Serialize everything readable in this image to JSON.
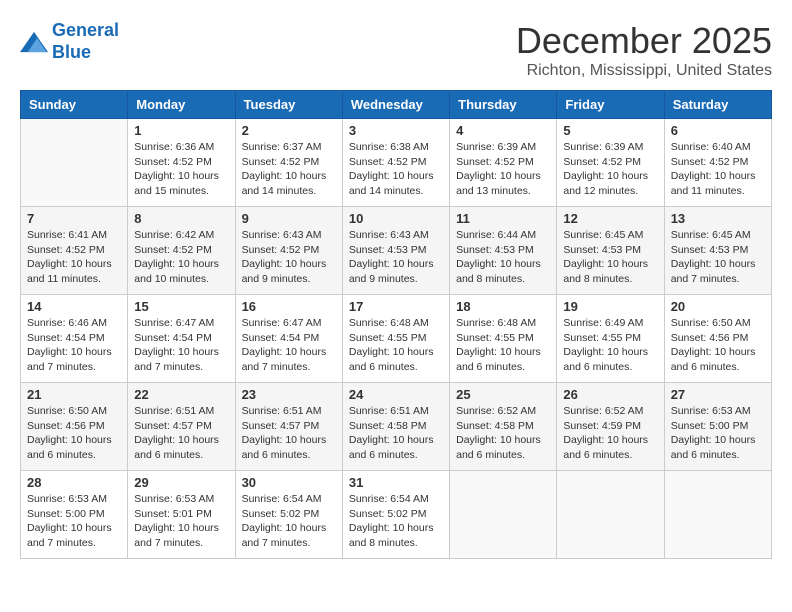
{
  "header": {
    "logo": {
      "line1": "General",
      "line2": "Blue"
    },
    "title": "December 2025",
    "location": "Richton, Mississippi, United States"
  },
  "days_of_week": [
    "Sunday",
    "Monday",
    "Tuesday",
    "Wednesday",
    "Thursday",
    "Friday",
    "Saturday"
  ],
  "weeks": [
    [
      {
        "day": "",
        "info": ""
      },
      {
        "day": "1",
        "info": "Sunrise: 6:36 AM\nSunset: 4:52 PM\nDaylight: 10 hours\nand 15 minutes."
      },
      {
        "day": "2",
        "info": "Sunrise: 6:37 AM\nSunset: 4:52 PM\nDaylight: 10 hours\nand 14 minutes."
      },
      {
        "day": "3",
        "info": "Sunrise: 6:38 AM\nSunset: 4:52 PM\nDaylight: 10 hours\nand 14 minutes."
      },
      {
        "day": "4",
        "info": "Sunrise: 6:39 AM\nSunset: 4:52 PM\nDaylight: 10 hours\nand 13 minutes."
      },
      {
        "day": "5",
        "info": "Sunrise: 6:39 AM\nSunset: 4:52 PM\nDaylight: 10 hours\nand 12 minutes."
      },
      {
        "day": "6",
        "info": "Sunrise: 6:40 AM\nSunset: 4:52 PM\nDaylight: 10 hours\nand 11 minutes."
      }
    ],
    [
      {
        "day": "7",
        "info": "Sunrise: 6:41 AM\nSunset: 4:52 PM\nDaylight: 10 hours\nand 11 minutes."
      },
      {
        "day": "8",
        "info": "Sunrise: 6:42 AM\nSunset: 4:52 PM\nDaylight: 10 hours\nand 10 minutes."
      },
      {
        "day": "9",
        "info": "Sunrise: 6:43 AM\nSunset: 4:52 PM\nDaylight: 10 hours\nand 9 minutes."
      },
      {
        "day": "10",
        "info": "Sunrise: 6:43 AM\nSunset: 4:53 PM\nDaylight: 10 hours\nand 9 minutes."
      },
      {
        "day": "11",
        "info": "Sunrise: 6:44 AM\nSunset: 4:53 PM\nDaylight: 10 hours\nand 8 minutes."
      },
      {
        "day": "12",
        "info": "Sunrise: 6:45 AM\nSunset: 4:53 PM\nDaylight: 10 hours\nand 8 minutes."
      },
      {
        "day": "13",
        "info": "Sunrise: 6:45 AM\nSunset: 4:53 PM\nDaylight: 10 hours\nand 7 minutes."
      }
    ],
    [
      {
        "day": "14",
        "info": "Sunrise: 6:46 AM\nSunset: 4:54 PM\nDaylight: 10 hours\nand 7 minutes."
      },
      {
        "day": "15",
        "info": "Sunrise: 6:47 AM\nSunset: 4:54 PM\nDaylight: 10 hours\nand 7 minutes."
      },
      {
        "day": "16",
        "info": "Sunrise: 6:47 AM\nSunset: 4:54 PM\nDaylight: 10 hours\nand 7 minutes."
      },
      {
        "day": "17",
        "info": "Sunrise: 6:48 AM\nSunset: 4:55 PM\nDaylight: 10 hours\nand 6 minutes."
      },
      {
        "day": "18",
        "info": "Sunrise: 6:48 AM\nSunset: 4:55 PM\nDaylight: 10 hours\nand 6 minutes."
      },
      {
        "day": "19",
        "info": "Sunrise: 6:49 AM\nSunset: 4:55 PM\nDaylight: 10 hours\nand 6 minutes."
      },
      {
        "day": "20",
        "info": "Sunrise: 6:50 AM\nSunset: 4:56 PM\nDaylight: 10 hours\nand 6 minutes."
      }
    ],
    [
      {
        "day": "21",
        "info": "Sunrise: 6:50 AM\nSunset: 4:56 PM\nDaylight: 10 hours\nand 6 minutes."
      },
      {
        "day": "22",
        "info": "Sunrise: 6:51 AM\nSunset: 4:57 PM\nDaylight: 10 hours\nand 6 minutes."
      },
      {
        "day": "23",
        "info": "Sunrise: 6:51 AM\nSunset: 4:57 PM\nDaylight: 10 hours\nand 6 minutes."
      },
      {
        "day": "24",
        "info": "Sunrise: 6:51 AM\nSunset: 4:58 PM\nDaylight: 10 hours\nand 6 minutes."
      },
      {
        "day": "25",
        "info": "Sunrise: 6:52 AM\nSunset: 4:58 PM\nDaylight: 10 hours\nand 6 minutes."
      },
      {
        "day": "26",
        "info": "Sunrise: 6:52 AM\nSunset: 4:59 PM\nDaylight: 10 hours\nand 6 minutes."
      },
      {
        "day": "27",
        "info": "Sunrise: 6:53 AM\nSunset: 5:00 PM\nDaylight: 10 hours\nand 6 minutes."
      }
    ],
    [
      {
        "day": "28",
        "info": "Sunrise: 6:53 AM\nSunset: 5:00 PM\nDaylight: 10 hours\nand 7 minutes."
      },
      {
        "day": "29",
        "info": "Sunrise: 6:53 AM\nSunset: 5:01 PM\nDaylight: 10 hours\nand 7 minutes."
      },
      {
        "day": "30",
        "info": "Sunrise: 6:54 AM\nSunset: 5:02 PM\nDaylight: 10 hours\nand 7 minutes."
      },
      {
        "day": "31",
        "info": "Sunrise: 6:54 AM\nSunset: 5:02 PM\nDaylight: 10 hours\nand 8 minutes."
      },
      {
        "day": "",
        "info": ""
      },
      {
        "day": "",
        "info": ""
      },
      {
        "day": "",
        "info": ""
      }
    ]
  ]
}
